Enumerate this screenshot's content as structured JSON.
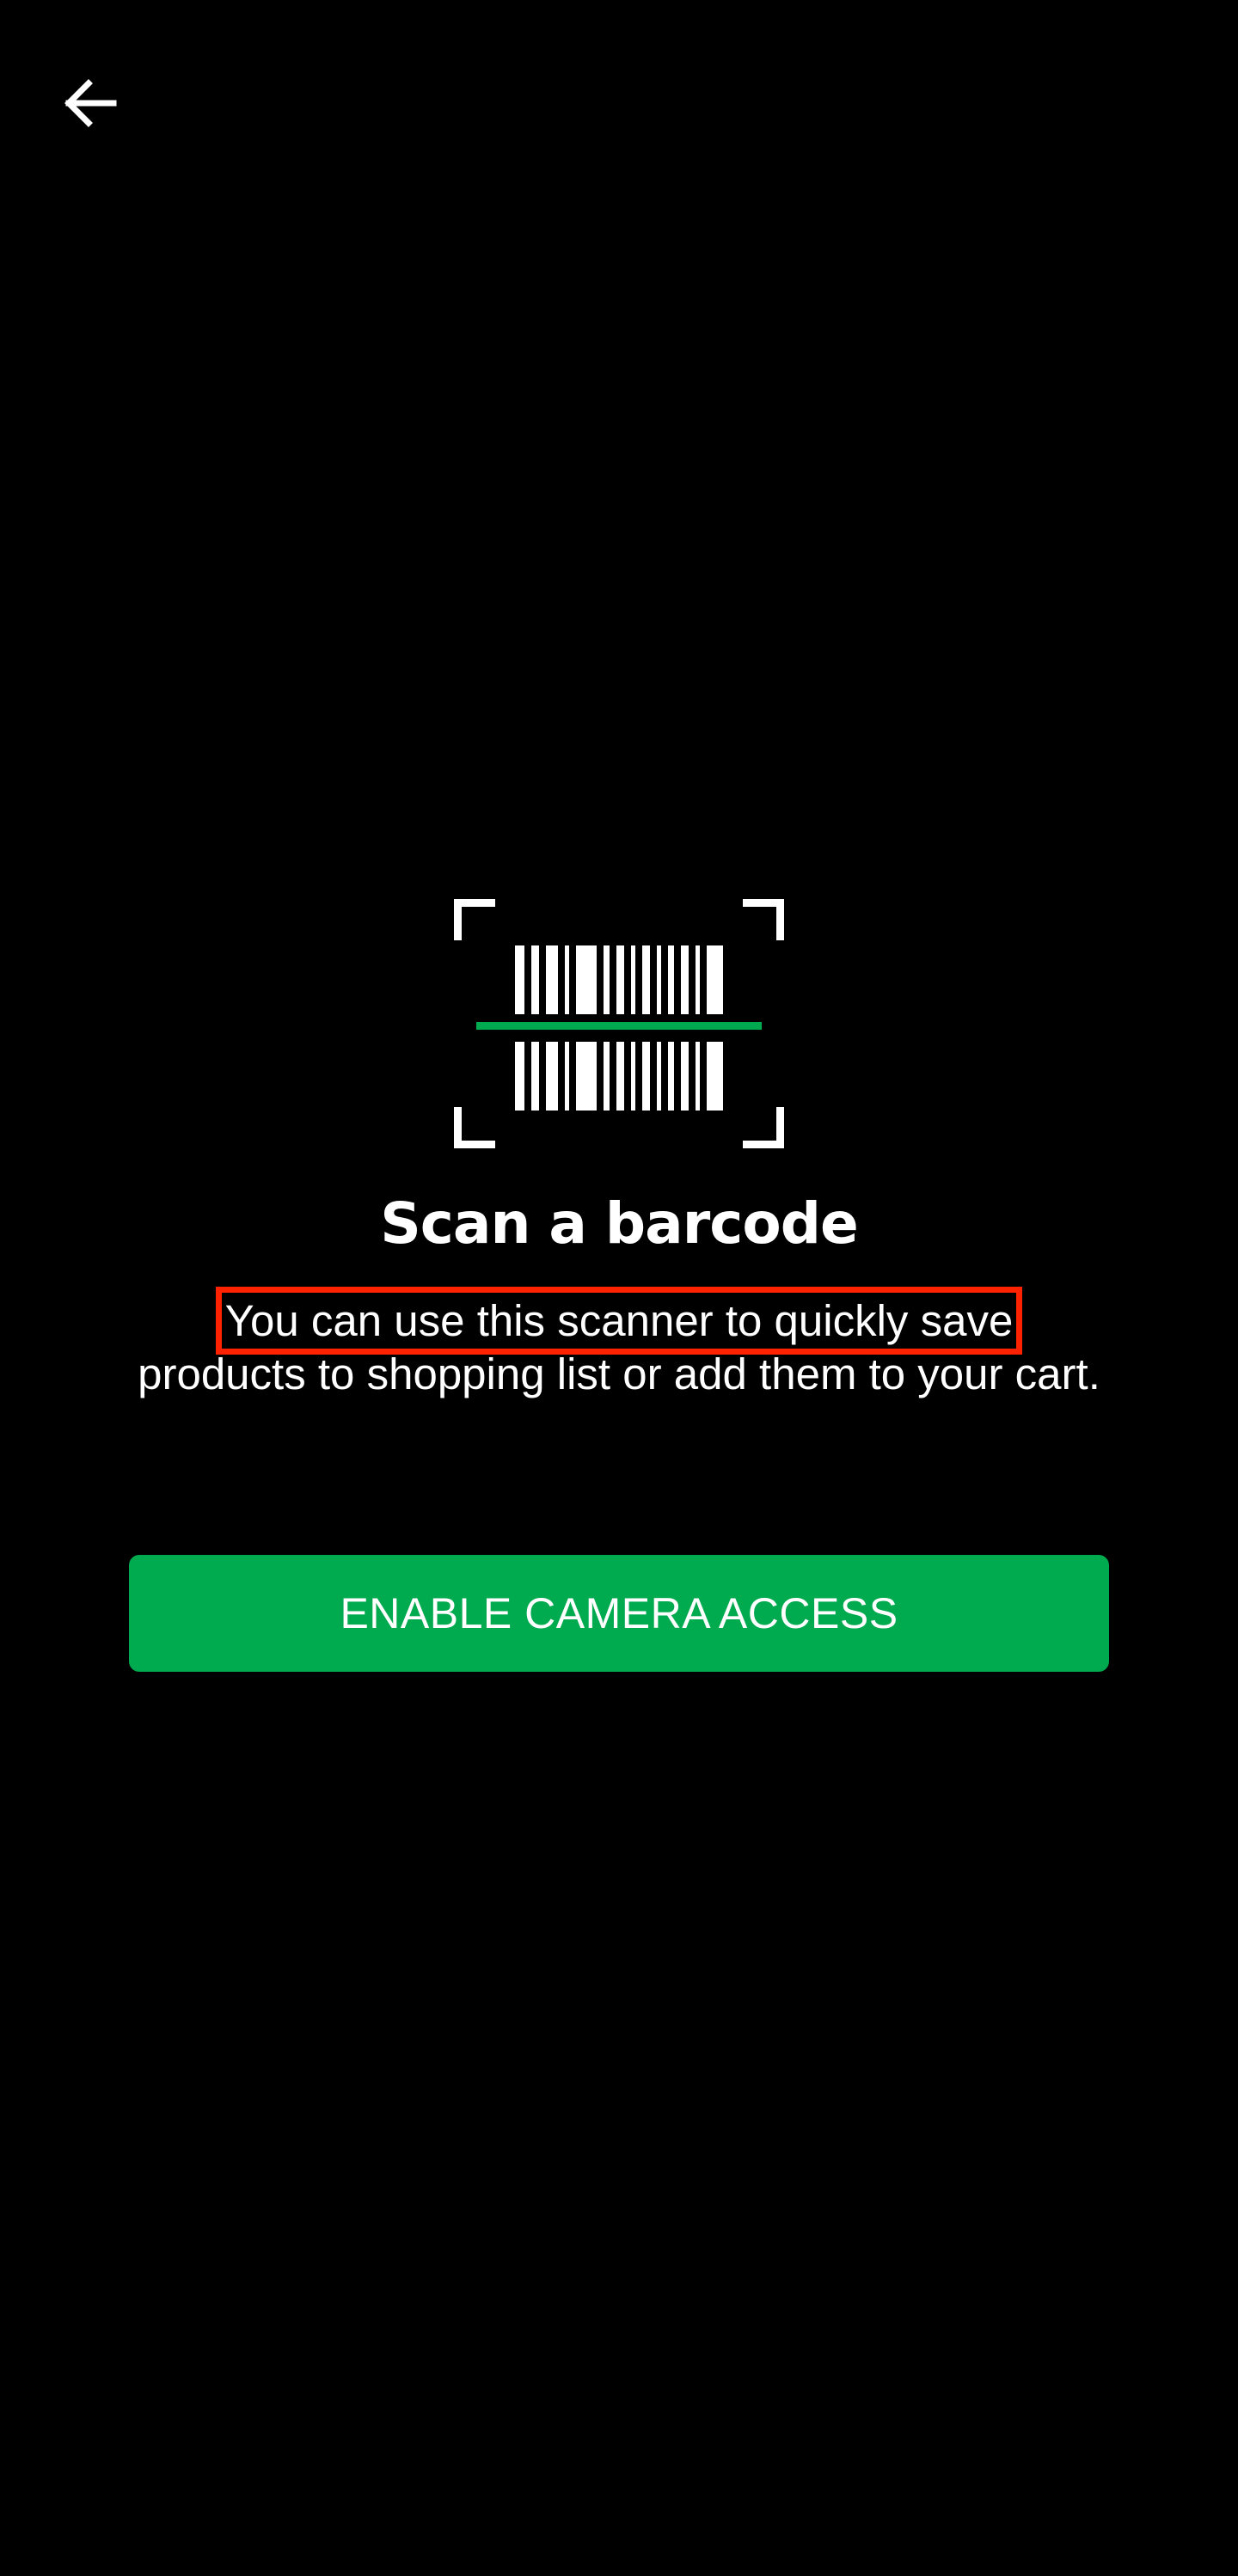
{
  "header": {
    "back_icon": "arrow-left-icon"
  },
  "illustration": {
    "icon": "barcode-scan-icon",
    "scan_line_color": "#00aa4f"
  },
  "content": {
    "title": "Scan a barcode",
    "description_highlighted": "You can use this scanner to quickly save",
    "description_rest": "products to shopping list or add them to your cart."
  },
  "cta": {
    "label": "ENABLE CAMERA ACCESS",
    "color": "#00aa4f"
  },
  "annotation": {
    "highlight_color": "#ff2200"
  }
}
